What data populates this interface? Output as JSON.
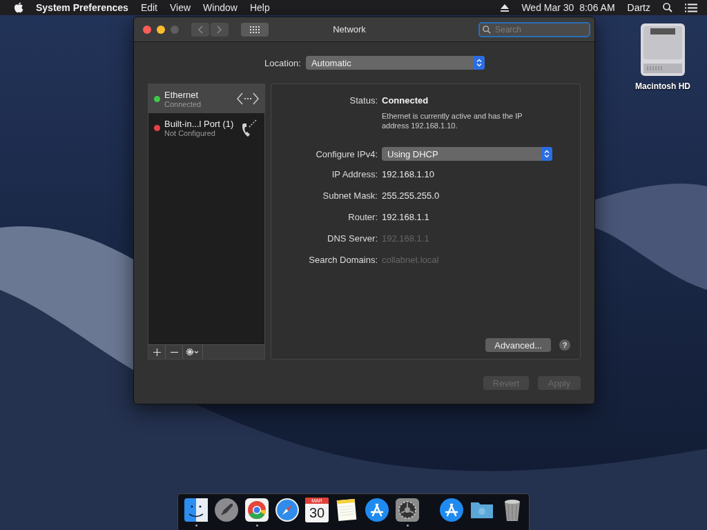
{
  "menu_bar": {
    "app_name": "System Preferences",
    "menus": [
      "Edit",
      "View",
      "Window",
      "Help"
    ],
    "clock": "Wed Mar 30  8:06 AM",
    "user": "Dartz"
  },
  "desktop_icons": [
    {
      "label": "Macintosh HD"
    }
  ],
  "window": {
    "title": "Network",
    "search": {
      "placeholder": "Search"
    },
    "location": {
      "label": "Location:",
      "value": "Automatic"
    },
    "services": [
      {
        "name": "Ethernet",
        "status": "Connected",
        "color": "#3dc94a",
        "selected": true,
        "kind": "ethernet"
      },
      {
        "name": "Built-in...l Port (1)",
        "status": "Not Configured",
        "color": "#e8414a",
        "selected": false,
        "kind": "phone"
      }
    ],
    "status": {
      "label": "Status:",
      "value": "Connected",
      "description": "Ethernet is currently active and has the IP address 192.168.1.10."
    },
    "details": [
      {
        "kind": "dropdown",
        "label": "Configure IPv4:",
        "value": "Using DHCP"
      },
      {
        "kind": "text",
        "label": "IP Address:",
        "value": "192.168.1.10",
        "disabled": false
      },
      {
        "kind": "text",
        "label": "Subnet Mask:",
        "value": "255.255.255.0",
        "disabled": false
      },
      {
        "kind": "text",
        "label": "Router:",
        "value": "192.168.1.1",
        "disabled": false
      },
      {
        "kind": "text",
        "label": "DNS Server:",
        "value": "192.168.1.1",
        "disabled": true
      },
      {
        "kind": "text",
        "label": "Search Domains:",
        "value": "collabnet.local",
        "disabled": true
      }
    ],
    "advanced_button": "Advanced...",
    "help_button": "?",
    "footer_buttons": [
      {
        "label": "Revert",
        "disabled": true
      },
      {
        "label": "Apply",
        "disabled": true
      }
    ]
  },
  "dock": [
    {
      "kind": "finder",
      "running": true
    },
    {
      "kind": "launchpad"
    },
    {
      "kind": "chrome",
      "running": true
    },
    {
      "kind": "safari"
    },
    {
      "kind": "calendar",
      "month": "MAR",
      "day": "30"
    },
    {
      "kind": "notes"
    },
    {
      "kind": "appstore"
    },
    {
      "kind": "prefs",
      "running": true
    },
    {
      "kind": "separator"
    },
    {
      "kind": "appstore"
    },
    {
      "kind": "folder"
    },
    {
      "kind": "trash"
    }
  ]
}
